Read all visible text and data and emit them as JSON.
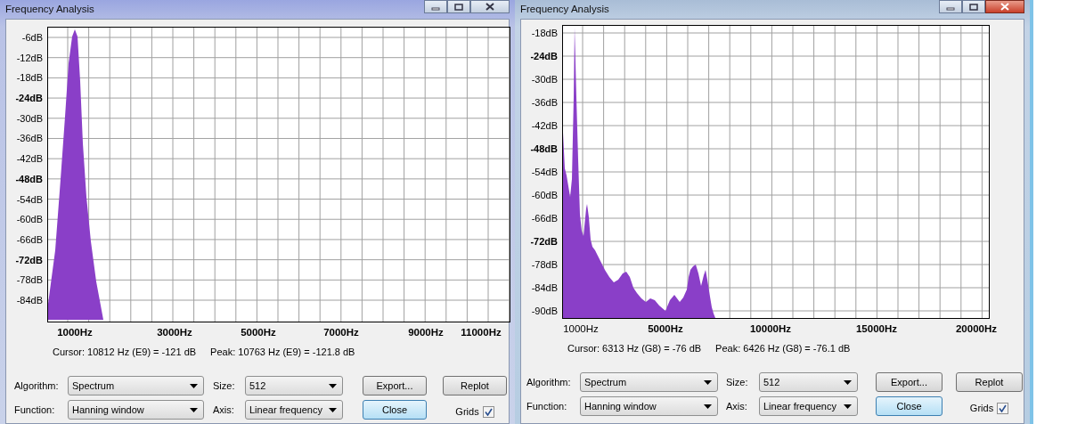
{
  "windows": [
    {
      "title": "Frequency Analysis",
      "active": false,
      "y_ticks": [
        {
          "label": "-6dB",
          "major": false
        },
        {
          "label": "-12dB",
          "major": false
        },
        {
          "label": "-18dB",
          "major": false
        },
        {
          "label": "-24dB",
          "major": true
        },
        {
          "label": "-30dB",
          "major": false
        },
        {
          "label": "-36dB",
          "major": false
        },
        {
          "label": "-42dB",
          "major": false
        },
        {
          "label": "-48dB",
          "major": true
        },
        {
          "label": "-54dB",
          "major": false
        },
        {
          "label": "-60dB",
          "major": false
        },
        {
          "label": "-66dB",
          "major": false
        },
        {
          "label": "-72dB",
          "major": true
        },
        {
          "label": "-78dB",
          "major": false
        },
        {
          "label": "-84dB",
          "major": false
        }
      ],
      "x_ticks": [
        {
          "label": "1000Hz",
          "major": true
        },
        {
          "label": "3000Hz",
          "major": true
        },
        {
          "label": "5000Hz",
          "major": true
        },
        {
          "label": "7000Hz",
          "major": true
        },
        {
          "label": "9000Hz",
          "major": true
        },
        {
          "label": "11000Hz",
          "major": true
        }
      ],
      "cursor_readout": "Cursor: 10812 Hz (E9) = -121 dB",
      "peak_readout": "Peak: 10763 Hz (E9) = -121.8 dB",
      "algorithm": {
        "label": "Algorithm:",
        "value": "Spectrum"
      },
      "size": {
        "label": "Size:",
        "value": "512"
      },
      "function": {
        "label": "Function:",
        "value": "Hanning window"
      },
      "axis": {
        "label": "Axis:",
        "value": "Linear frequency"
      },
      "export_button": {
        "label": "Export...",
        "focused": false
      },
      "replot_button": {
        "label": "Replot",
        "focused": false
      },
      "close_button": {
        "label": "Close",
        "focused": true
      },
      "grids": {
        "label": "Grids",
        "checked": true
      }
    },
    {
      "title": "Frequency Analysis",
      "active": true,
      "y_ticks": [
        {
          "label": "-18dB",
          "major": false
        },
        {
          "label": "-24dB",
          "major": true
        },
        {
          "label": "-30dB",
          "major": false
        },
        {
          "label": "-36dB",
          "major": false
        },
        {
          "label": "-42dB",
          "major": false
        },
        {
          "label": "-48dB",
          "major": true
        },
        {
          "label": "-54dB",
          "major": false
        },
        {
          "label": "-60dB",
          "major": false
        },
        {
          "label": "-66dB",
          "major": false
        },
        {
          "label": "-72dB",
          "major": true
        },
        {
          "label": "-78dB",
          "major": false
        },
        {
          "label": "-84dB",
          "major": false
        },
        {
          "label": "-90dB",
          "major": false
        }
      ],
      "x_ticks": [
        {
          "label": "1000Hz",
          "major": false
        },
        {
          "label": "5000Hz",
          "major": true
        },
        {
          "label": "10000Hz",
          "major": true
        },
        {
          "label": "15000Hz",
          "major": true
        },
        {
          "label": "20000Hz",
          "major": true
        }
      ],
      "cursor_readout": "Cursor: 6313 Hz (G8) = -76 dB",
      "peak_readout": "Peak: 6426 Hz (G8) = -76.1 dB",
      "algorithm": {
        "label": "Algorithm:",
        "value": "Spectrum"
      },
      "size": {
        "label": "Size:",
        "value": "512"
      },
      "function": {
        "label": "Function:",
        "value": "Hanning window"
      },
      "axis": {
        "label": "Axis:",
        "value": "Linear frequency"
      },
      "export_button": {
        "label": "Export...",
        "focused": false
      },
      "replot_button": {
        "label": "Replot",
        "focused": false
      },
      "close_button": {
        "label": "Close",
        "focused": true
      },
      "grids": {
        "label": "Grids",
        "checked": true
      }
    }
  ]
}
